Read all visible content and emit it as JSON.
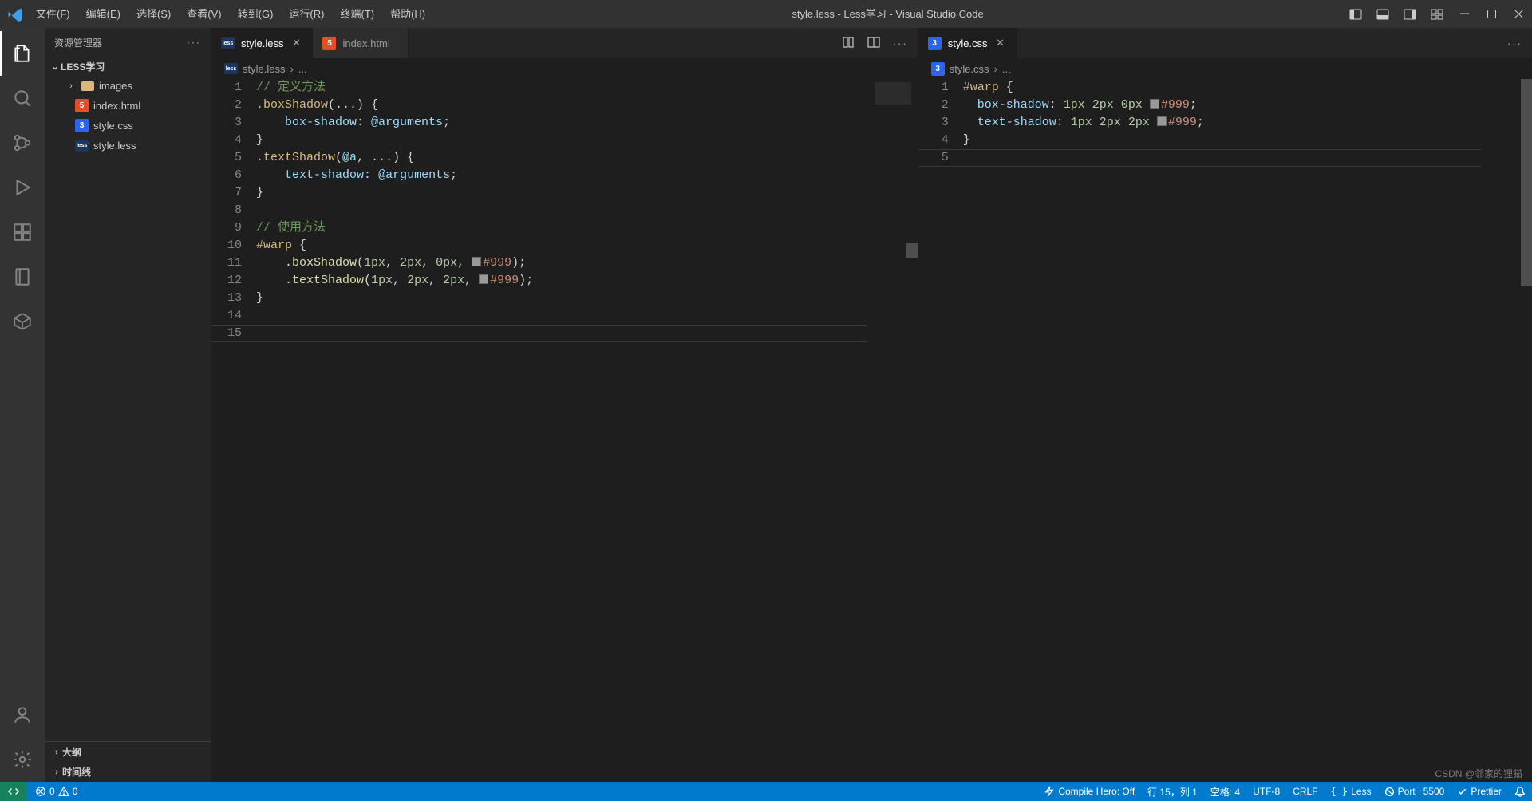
{
  "title": "style.less - Less学习 - Visual Studio Code",
  "menu": {
    "file": "文件(F)",
    "edit": "编辑(E)",
    "selection": "选择(S)",
    "view": "查看(V)",
    "go": "转到(G)",
    "run": "运行(R)",
    "terminal": "终端(T)",
    "help": "帮助(H)"
  },
  "sidebar": {
    "title": "资源管理器",
    "project": "LESS学习",
    "items": [
      {
        "kind": "folder",
        "name": "images"
      },
      {
        "kind": "html",
        "name": "index.html"
      },
      {
        "kind": "css",
        "name": "style.css"
      },
      {
        "kind": "less",
        "name": "style.less"
      }
    ],
    "sections": {
      "outline": "大纲",
      "timeline": "时间线"
    }
  },
  "tabsLeft": [
    {
      "icon": "less",
      "label": "style.less",
      "active": true,
      "close": true
    },
    {
      "icon": "html",
      "label": "index.html",
      "active": false,
      "close": false
    }
  ],
  "tabsRight": [
    {
      "icon": "css",
      "label": "style.css",
      "active": true,
      "close": true
    }
  ],
  "breadcrumb": {
    "left": {
      "icon": "less",
      "file": "style.less",
      "rest": "..."
    },
    "right": {
      "icon": "css",
      "file": "style.css",
      "rest": "..."
    }
  },
  "codeLeft": {
    "lines": 15,
    "cursorLine": 15,
    "src": [
      {
        "cmt": "// 定义方法"
      },
      {
        "raw": [
          [
            "sel",
            ".boxShadow"
          ],
          [
            "punc",
            "("
          ],
          [
            "punc",
            "..."
          ],
          [
            "punc",
            ")"
          ],
          [
            "punc",
            " "
          ],
          [
            "brace",
            "{"
          ]
        ]
      },
      {
        "indent": 4,
        "raw": [
          [
            "prop",
            "box-shadow"
          ],
          [
            "punc",
            ": "
          ],
          [
            "var",
            "@arguments"
          ],
          [
            "punc",
            ";"
          ]
        ]
      },
      {
        "raw": [
          [
            "brace",
            "}"
          ]
        ]
      },
      {
        "raw": [
          [
            "sel",
            ".textShadow"
          ],
          [
            "punc",
            "("
          ],
          [
            "var",
            "@a"
          ],
          [
            "punc",
            ", "
          ],
          [
            "punc",
            "..."
          ],
          [
            "punc",
            ")"
          ],
          [
            "punc",
            " "
          ],
          [
            "brace",
            "{"
          ]
        ]
      },
      {
        "indent": 4,
        "raw": [
          [
            "prop",
            "text-shadow"
          ],
          [
            "punc",
            ": "
          ],
          [
            "var",
            "@arguments"
          ],
          [
            "punc",
            ";"
          ]
        ]
      },
      {
        "raw": [
          [
            "brace",
            "}"
          ]
        ]
      },
      {
        "blank": true
      },
      {
        "cmt": "// 使用方法"
      },
      {
        "raw": [
          [
            "sel",
            "#warp"
          ],
          [
            "punc",
            " "
          ],
          [
            "brace",
            "{"
          ]
        ]
      },
      {
        "indent": 4,
        "raw": [
          [
            "call",
            ".boxShadow"
          ],
          [
            "punc",
            "("
          ],
          [
            "num",
            "1px"
          ],
          [
            "punc",
            ", "
          ],
          [
            "num",
            "2px"
          ],
          [
            "punc",
            ", "
          ],
          [
            "num",
            "0px"
          ],
          [
            "punc",
            ", "
          ],
          [
            "swatch",
            ""
          ],
          [
            "hex",
            "#999"
          ],
          [
            "punc",
            ")"
          ],
          [
            "punc",
            ";"
          ]
        ]
      },
      {
        "indent": 4,
        "raw": [
          [
            "call",
            ".textShadow"
          ],
          [
            "punc",
            "("
          ],
          [
            "num",
            "1px"
          ],
          [
            "punc",
            ", "
          ],
          [
            "num",
            "2px"
          ],
          [
            "punc",
            ", "
          ],
          [
            "num",
            "2px"
          ],
          [
            "punc",
            ", "
          ],
          [
            "swatch",
            ""
          ],
          [
            "hex",
            "#999"
          ],
          [
            "punc",
            ")"
          ],
          [
            "punc",
            ";"
          ]
        ]
      },
      {
        "raw": [
          [
            "brace",
            "}"
          ]
        ]
      },
      {
        "blank": true
      },
      {
        "blank": true
      }
    ]
  },
  "codeRight": {
    "lines": 5,
    "cursorLine": 5,
    "src": [
      {
        "raw": [
          [
            "sel",
            "#warp"
          ],
          [
            "punc",
            " "
          ],
          [
            "brace",
            "{"
          ]
        ]
      },
      {
        "indent": 2,
        "raw": [
          [
            "prop",
            "box-shadow"
          ],
          [
            "punc",
            ": "
          ],
          [
            "num",
            "1px"
          ],
          [
            "punc",
            " "
          ],
          [
            "num",
            "2px"
          ],
          [
            "punc",
            " "
          ],
          [
            "num",
            "0px"
          ],
          [
            "punc",
            " "
          ],
          [
            "swatch",
            ""
          ],
          [
            "hex",
            "#999"
          ],
          [
            "punc",
            ";"
          ]
        ]
      },
      {
        "indent": 2,
        "raw": [
          [
            "prop",
            "text-shadow"
          ],
          [
            "punc",
            ": "
          ],
          [
            "num",
            "1px"
          ],
          [
            "punc",
            " "
          ],
          [
            "num",
            "2px"
          ],
          [
            "punc",
            " "
          ],
          [
            "num",
            "2px"
          ],
          [
            "punc",
            " "
          ],
          [
            "swatch",
            ""
          ],
          [
            "hex",
            "#999"
          ],
          [
            "punc",
            ";"
          ]
        ]
      },
      {
        "raw": [
          [
            "brace",
            "}"
          ]
        ]
      },
      {
        "blank": true
      }
    ]
  },
  "status": {
    "errors": "0",
    "warnings": "0",
    "compileHero": "Compile Hero: Off",
    "pos": "行 15，列 1",
    "spaces": "空格: 4",
    "encoding": "UTF-8",
    "eol": "CRLF",
    "lang": "Less",
    "port": "Port : 5500",
    "prettier": "Prettier"
  },
  "watermark": "CSDN @邻家的狸猫"
}
